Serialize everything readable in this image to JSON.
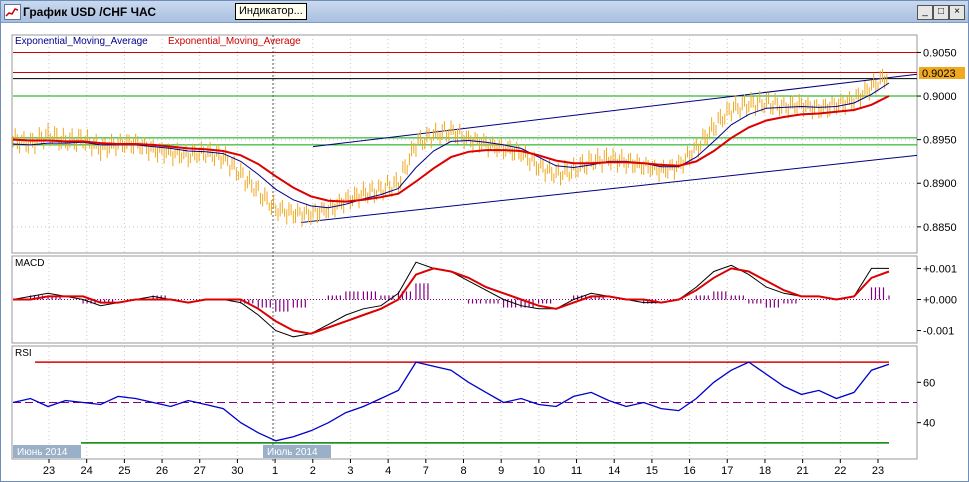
{
  "window": {
    "title": "График USD /CHF ЧАС",
    "tooltip": "Индикатор...",
    "buttons": {
      "minimize": "_",
      "maximize": "□",
      "close": "×"
    }
  },
  "colors": {
    "candle": "#f0a820",
    "ema_fast": "#00008b",
    "ema_slow": "#dd0000",
    "channel": "#000080",
    "hline_red": "#cc0000",
    "hline_green": "#00aa00",
    "macd_hist": "#800080",
    "rsi_line": "#0000cc",
    "rsi_upper": "#dd0000",
    "rsi_mid": "#800080",
    "rsi_lower": "#008000",
    "price_label_bg": "#f0a820"
  },
  "main_panel": {
    "legend": [
      "Exponential_Moving_Average",
      "Exponential_Moving_Average"
    ],
    "y_ticks": [
      "0.9050",
      "0.9000",
      "0.8950",
      "0.8900",
      "0.8850"
    ],
    "current_price": "0.9023"
  },
  "macd_panel": {
    "label": "MACD",
    "y_ticks": [
      "+0.001",
      "+0.000",
      "-0.001"
    ]
  },
  "rsi_panel": {
    "label": "RSI",
    "y_ticks": [
      "60",
      "40"
    ]
  },
  "x_axis": {
    "ticks": [
      "23",
      "24",
      "25",
      "26",
      "27",
      "30",
      "1",
      "2",
      "3",
      "4",
      "7",
      "8",
      "9",
      "10",
      "11",
      "14",
      "15",
      "16",
      "17",
      "18",
      "21",
      "22",
      "23"
    ],
    "month_labels": [
      "Июнь 2014",
      "Июль 2014"
    ]
  },
  "chart_data": {
    "type": "line",
    "price": {
      "ylim": [
        0.882,
        0.907
      ],
      "close": [
        0.895,
        0.8945,
        0.8955,
        0.8948,
        0.895,
        0.894,
        0.8945,
        0.8946,
        0.8938,
        0.8935,
        0.8932,
        0.8935,
        0.893,
        0.891,
        0.889,
        0.887,
        0.8865,
        0.8865,
        0.887,
        0.888,
        0.8888,
        0.8892,
        0.89,
        0.8945,
        0.8955,
        0.896,
        0.895,
        0.8945,
        0.894,
        0.8935,
        0.892,
        0.891,
        0.8915,
        0.8925,
        0.8928,
        0.8925,
        0.892,
        0.8915,
        0.892,
        0.894,
        0.8965,
        0.8985,
        0.899,
        0.8992,
        0.8988,
        0.899,
        0.8985,
        0.899,
        0.8995,
        0.901,
        0.9025
      ],
      "ema_fast": [
        0.8945,
        0.8944,
        0.8946,
        0.8946,
        0.8947,
        0.8944,
        0.8944,
        0.8944,
        0.8942,
        0.894,
        0.8937,
        0.8936,
        0.8934,
        0.8925,
        0.891,
        0.8893,
        0.8881,
        0.8874,
        0.8872,
        0.8876,
        0.8882,
        0.8887,
        0.8894,
        0.8918,
        0.8937,
        0.8948,
        0.8949,
        0.8947,
        0.8944,
        0.894,
        0.893,
        0.892,
        0.8918,
        0.8921,
        0.8925,
        0.8925,
        0.8923,
        0.8919,
        0.8919,
        0.893,
        0.8948,
        0.8967,
        0.8979,
        0.8986,
        0.8987,
        0.8988,
        0.8987,
        0.8988,
        0.8992,
        0.9002,
        0.9015
      ],
      "ema_slow": [
        0.895,
        0.8949,
        0.8949,
        0.8948,
        0.8948,
        0.8946,
        0.8945,
        0.8945,
        0.8944,
        0.8942,
        0.894,
        0.8939,
        0.8937,
        0.8932,
        0.8922,
        0.8908,
        0.8895,
        0.8885,
        0.888,
        0.8879,
        0.8881,
        0.8884,
        0.8888,
        0.8902,
        0.8917,
        0.893,
        0.8936,
        0.8938,
        0.8938,
        0.8937,
        0.8932,
        0.8926,
        0.8923,
        0.8923,
        0.8924,
        0.8924,
        0.8923,
        0.8921,
        0.892,
        0.8925,
        0.8937,
        0.8952,
        0.8964,
        0.8972,
        0.8976,
        0.8979,
        0.898,
        0.8982,
        0.8984,
        0.899,
        0.9
      ],
      "channel_upper": [
        [
          0.8942,
          0.9025
        ]
      ],
      "channel_lower": [
        [
          0.8855,
          0.8932
        ]
      ],
      "red_levels": [
        0.905,
        0.9027
      ],
      "green_levels": [
        0.9,
        0.8952,
        0.8944
      ],
      "black_level": 0.902
    },
    "macd": {
      "ylim": [
        -0.0014,
        0.0014
      ],
      "macd": [
        0.0,
        0.0001,
        0.0002,
        0.0001,
        0.0,
        -0.0002,
        -0.0001,
        0.0,
        0.0001,
        0.0,
        -0.0001,
        0.0,
        0.0,
        -0.0001,
        -0.0005,
        -0.001,
        -0.0012,
        -0.0011,
        -0.0008,
        -0.0005,
        -0.0003,
        -0.0002,
        0.0002,
        0.0012,
        0.001,
        0.0009,
        0.0006,
        0.0003,
        0.0,
        -0.0002,
        -0.0003,
        -0.0003,
        0.0,
        0.0002,
        0.0001,
        0.0,
        -0.0001,
        -0.0001,
        0.0,
        0.0004,
        0.0009,
        0.0011,
        0.0008,
        0.0004,
        0.0002,
        0.0001,
        0.0001,
        0.0,
        0.0001,
        0.001,
        0.001
      ],
      "signal": [
        0.0,
        0.0,
        0.0001,
        0.0001,
        0.0001,
        -0.0001,
        -0.0001,
        0.0,
        0.0,
        0.0,
        -0.0001,
        0.0,
        0.0,
        0.0,
        -0.0003,
        -0.0007,
        -0.001,
        -0.0011,
        -0.0009,
        -0.0007,
        -0.0005,
        -0.0003,
        0.0,
        0.0008,
        0.001,
        0.0009,
        0.0007,
        0.0004,
        0.0002,
        0.0,
        -0.0002,
        -0.0003,
        -0.0001,
        0.0001,
        0.0001,
        0.0,
        0.0,
        -0.0001,
        0.0,
        0.0003,
        0.0007,
        0.001,
        0.0009,
        0.0006,
        0.0003,
        0.0001,
        0.0001,
        0.0,
        0.0001,
        0.0007,
        0.0009
      ]
    },
    "rsi": {
      "ylim": [
        22,
        78
      ],
      "values": [
        50,
        52,
        48,
        51,
        50,
        49,
        53,
        52,
        50,
        48,
        51,
        49,
        47,
        40,
        35,
        31,
        33,
        36,
        40,
        45,
        48,
        52,
        56,
        70,
        68,
        66,
        60,
        55,
        50,
        52,
        49,
        48,
        53,
        55,
        51,
        48,
        50,
        47,
        46,
        52,
        60,
        66,
        70,
        64,
        58,
        54,
        56,
        52,
        55,
        66,
        69
      ],
      "upper": 70,
      "mid": 50,
      "lower": 30
    }
  }
}
